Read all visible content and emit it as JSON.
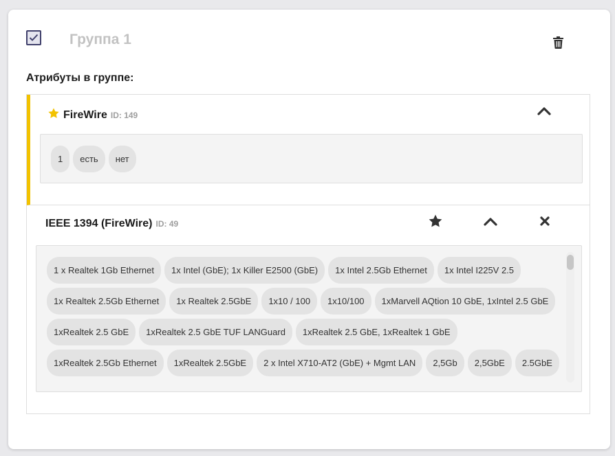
{
  "group": {
    "title": "Группа 1",
    "checked": true
  },
  "attributes_heading": "Атрибуты в группе:",
  "attributes": [
    {
      "name": "FireWire",
      "id_label": "ID: 149",
      "favorite": true,
      "accent_color": "#f2c200",
      "values": [
        "1",
        "есть",
        "нет"
      ]
    },
    {
      "name": "IEEE 1394 (FireWire)",
      "id_label": "ID: 49",
      "favorite": false,
      "values": [
        "1 x Realtek 1Gb Ethernet",
        "1x Intel (GbE); 1x Killer E2500 (GbE)",
        "1x Intel 2.5Gb Ethernet",
        "1x Intel I225V 2.5",
        "1x Realtek 2.5Gb Ethernet",
        "1x Realtek 2.5GbE",
        "1x10 / 100",
        "1x10/100",
        "1xMarvell AQtion 10 GbE, 1xIntel 2.5 GbE",
        "1xRealtek 2.5 GbE",
        "1xRealtek 2.5 GbE TUF LANGuard",
        "1xRealtek 2.5 GbE, 1xRealtek 1 GbE",
        "1xRealtek 2.5Gb Ethernet",
        "1xRealtek 2.5GbE",
        "2 x Intel X710-AT2 (GbE) + Mgmt LAN",
        "2,5Gb",
        "2,5GbE",
        "2.5GbE"
      ]
    }
  ],
  "icons": {
    "checkbox": "check-icon",
    "delete": "trash-icon",
    "favorite": "star-icon",
    "collapse": "chevron-up-icon",
    "remove": "close-icon"
  },
  "colors": {
    "accent": "#f2c200",
    "checkbox_border": "#3f3f6b",
    "icon": "#333333",
    "chip_bg": "#e3e3e3"
  }
}
